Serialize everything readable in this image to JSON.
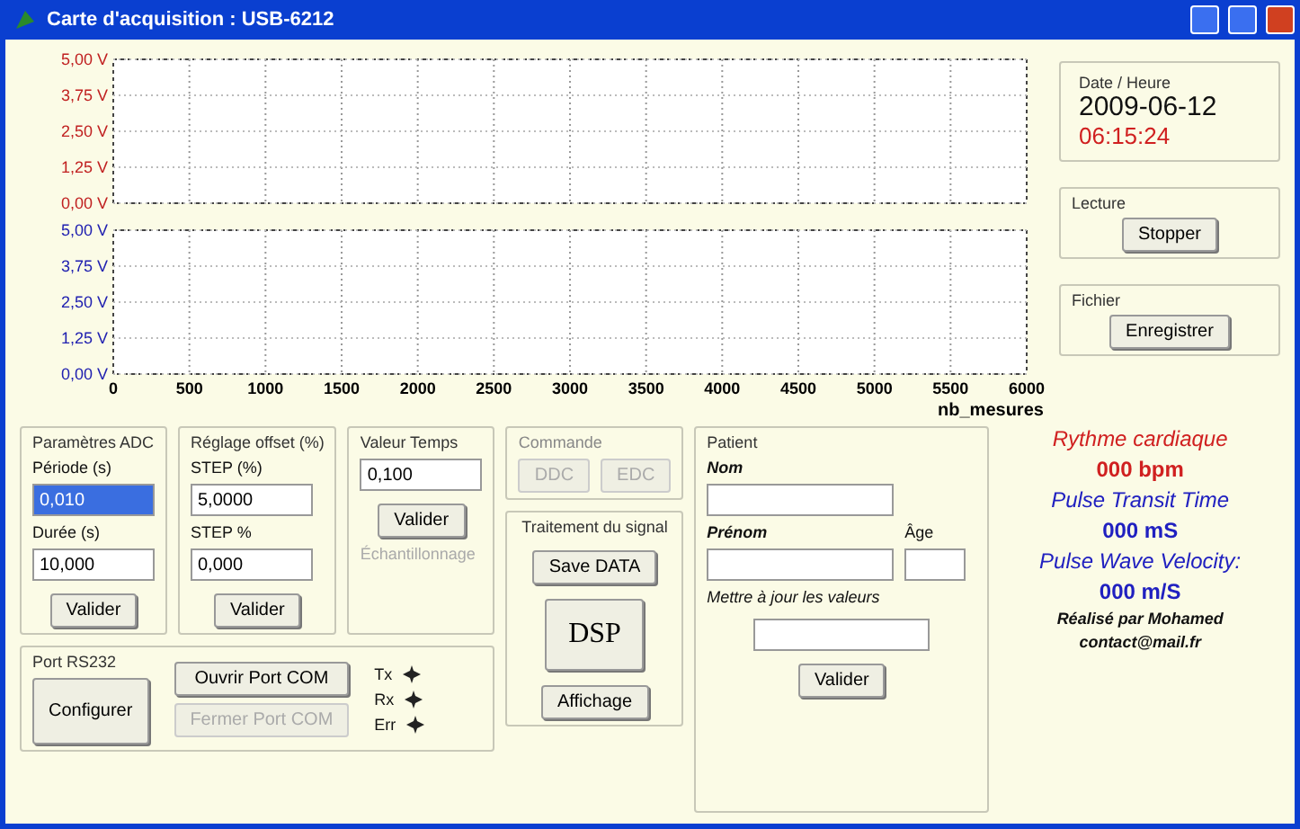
{
  "window": {
    "title": "Carte d'acquisition : USB-6212"
  },
  "charts": [
    {
      "chart_data": {
        "type": "line",
        "grid": true,
        "xlim": [
          0,
          6000
        ],
        "ylim": [
          0,
          5
        ],
        "yticks": [
          {
            "value": 5,
            "label": "5,00 V"
          },
          {
            "value": 3.75,
            "label": "3,75 V"
          },
          {
            "value": 2.5,
            "label": "2,50 V"
          },
          {
            "value": 1.25,
            "label": "1,25 V"
          },
          {
            "value": 0,
            "label": "0,00 V"
          }
        ]
      }
    },
    {
      "chart_data": {
        "type": "line",
        "grid": true,
        "xlim": [
          0,
          6000
        ],
        "ylim": [
          0,
          5
        ],
        "xlabel": "nb_mesures",
        "yticks": [
          {
            "value": 5,
            "label": "5,00 V"
          },
          {
            "value": 3.75,
            "label": "3,75 V"
          },
          {
            "value": 2.5,
            "label": "2,50 V"
          },
          {
            "value": 1.25,
            "label": "1,25 V"
          },
          {
            "value": 0,
            "label": "0,00 V"
          }
        ],
        "xticks": [
          0,
          500,
          1000,
          1500,
          2000,
          2500,
          3000,
          3500,
          4000,
          4500,
          5000,
          5500,
          6000
        ]
      }
    }
  ],
  "datetime": {
    "label": "Date / Heure",
    "date": "2009-06-12",
    "time": "06:15:24"
  },
  "side_groups": [
    {
      "label": "Lecture",
      "button": "Stopper"
    },
    {
      "label": "Fichier",
      "button": "Enregistrer"
    }
  ],
  "adc": {
    "label": "Paramètres ADC",
    "fields": [
      {
        "label": "Période (s)",
        "value": "0,010",
        "selected": true
      },
      {
        "label": "Durée (s)",
        "value": "10,000",
        "selected": false
      }
    ],
    "button": "Valider"
  },
  "offset": {
    "label": "Réglage offset (%)",
    "fields": [
      {
        "label": "STEP (%)",
        "value": "5,0000"
      },
      {
        "label": "STEP %",
        "value": "0,000"
      }
    ],
    "button": "Valider"
  },
  "temps": {
    "label": "Valeur Temps",
    "value": "0,100",
    "button": "Valider",
    "note": "Échantillonnage"
  },
  "commande": {
    "label": "Commande",
    "buttons": [
      {
        "label": "DDC",
        "disabled": true
      },
      {
        "label": "EDC",
        "disabled": true
      }
    ]
  },
  "traitement": {
    "label": "Traitement du signal",
    "buttons": [
      "Save DATA",
      "DSP",
      "Affichage"
    ]
  },
  "patient": {
    "label": "Patient",
    "name_label": "Nom",
    "firstname_label": "Prénom",
    "age_label": "Âge",
    "update_label": "Mettre à jour les valeurs",
    "button": "Valider"
  },
  "port": {
    "label": "Port RS232",
    "configure": "Configurer",
    "buttons": [
      {
        "label": "Ouvrir Port COM",
        "disabled": false
      },
      {
        "label": "Fermer Port COM",
        "disabled": true
      }
    ],
    "leds": [
      "Tx",
      "Rx",
      "Err"
    ]
  },
  "readouts": [
    {
      "label": "Rythme cardiaque",
      "value": "000 bpm",
      "color": "#d02020"
    },
    {
      "label": "Pulse Transit Time",
      "value": "000 mS",
      "color": "#2020c0"
    },
    {
      "label": "Pulse Wave Velocity:",
      "value": "000 m/S",
      "color": "#2020c0"
    }
  ],
  "credits": [
    "Réalisé par Mohamed",
    "contact@mail.fr"
  ]
}
